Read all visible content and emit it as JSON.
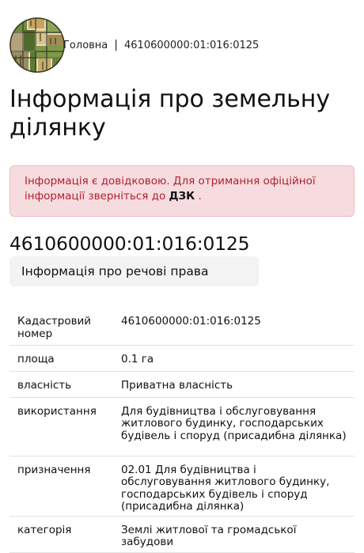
{
  "breadcrumb": {
    "home_label": "Головна",
    "separator": "|",
    "current": "4610600000:01:016:0125"
  },
  "page_title": "Інформація про земельну ділянку",
  "notice": {
    "text_before_link": "Інформація є довідковою. Для отримання офіційної інформації зверніться до",
    "link_label": "ДЗК",
    "text_after_link": " ."
  },
  "cadastral_number": "4610600000:01:016:0125",
  "tab_rights_label": "Інформація про речові права",
  "table": {
    "rows": [
      {
        "label": "Кадастровий номер",
        "value": "4610600000:01:016:0125"
      },
      {
        "label": "площа",
        "value": "0.1 га"
      },
      {
        "label": "власність",
        "value": "Приватна власність"
      },
      {
        "label": "використання",
        "value": "Для будівництва і обслуговування житлового будинку, господарських будівель і споруд (присадибна ділянка)"
      },
      {
        "label": "призначення",
        "value": "02.01 Для будівництва і обслуговування житлового будинку, господарських будівель і споруд (присадибна ділянка)"
      },
      {
        "label": "категорія",
        "value": "Землі житлової та громадської забудови"
      }
    ]
  },
  "colors": {
    "notice_background": "#f7dcdf",
    "notice_border": "#f0b9c0",
    "notice_text": "#b1202f",
    "tab_background": "#f3f3f3",
    "row_divider": "#e3e3e3"
  },
  "icons": {
    "logo": "city-map-logo-icon"
  }
}
